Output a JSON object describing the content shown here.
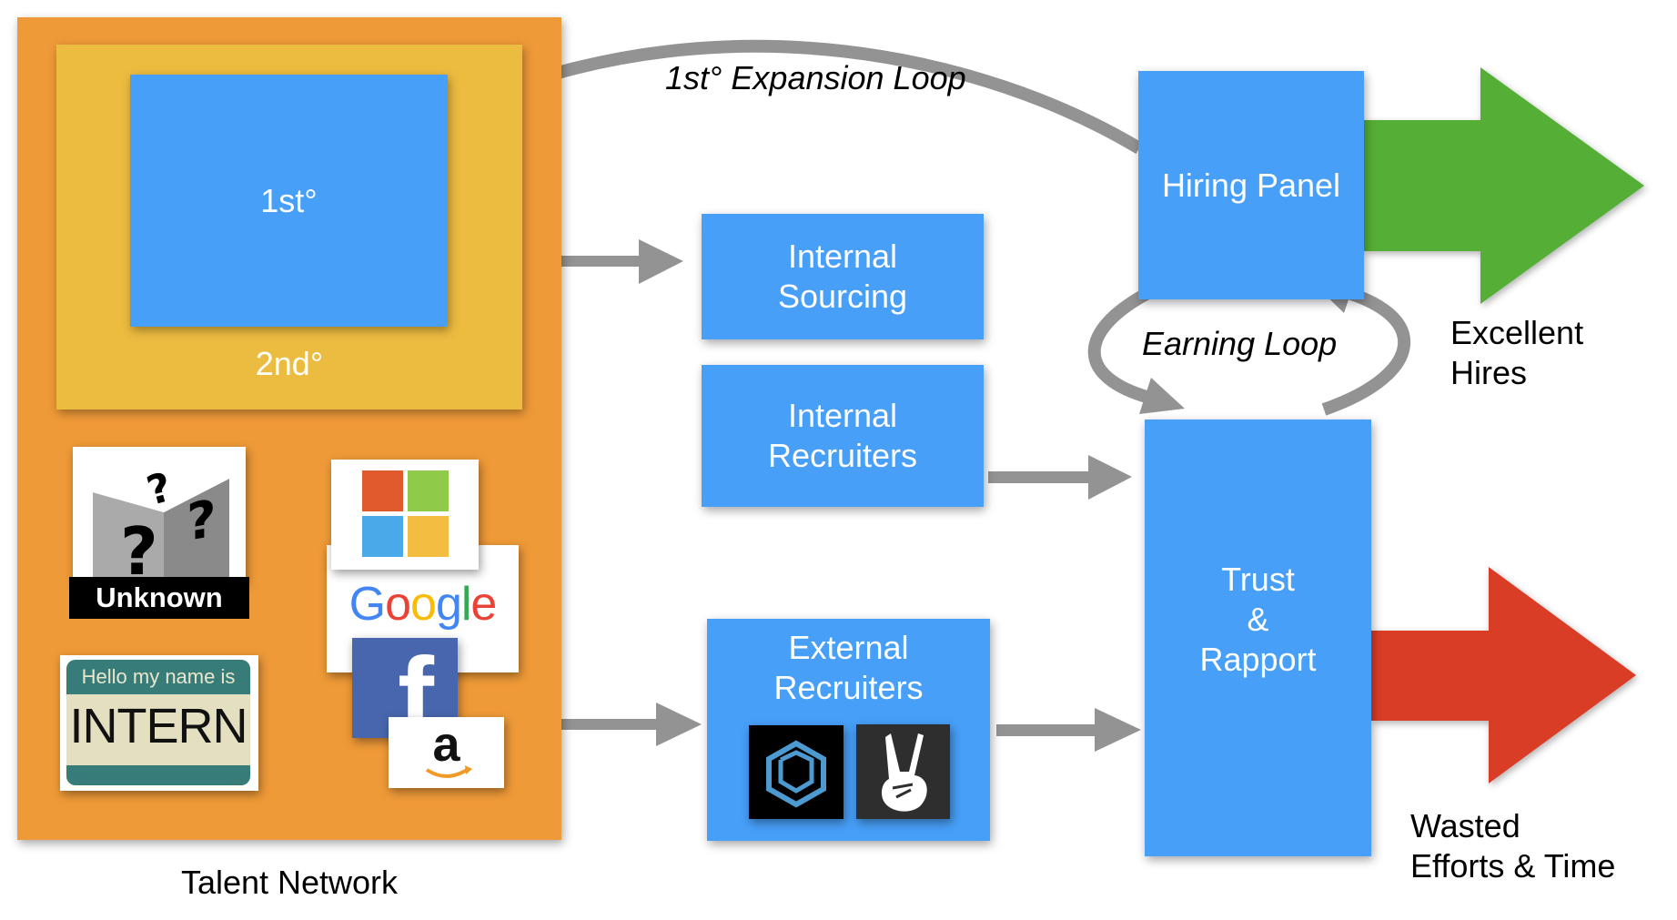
{
  "talent_network": {
    "label": "Talent Network",
    "first_degree": "1st°",
    "second_degree": "2nd°",
    "sources": {
      "unknown": "Unknown",
      "intern_header": "Hello my name is",
      "intern_name": "INTERN",
      "google": "Google",
      "facebook": "f",
      "amazon": "a"
    }
  },
  "nodes": {
    "internal_sourcing": "Internal\nSourcing",
    "internal_recruiters": "Internal\nRecruiters",
    "external_recruiters": "External\nRecruiters",
    "hiring_panel": "Hiring Panel",
    "trust_rapport": "Trust\n&\nRapport"
  },
  "loops": {
    "expansion": "1st° Expansion Loop",
    "earning": "Earning Loop"
  },
  "outcomes": {
    "excellent_hires": "Excellent\nHires",
    "wasted": "Wasted\nEfforts & Time"
  },
  "colors": {
    "node_blue": "#479ff8",
    "network_orange": "#ef9a38",
    "second_degree_yellow": "#ecbc40",
    "arrow_gray": "#939393",
    "success_green": "#55ae35",
    "waste_red": "#d93d27"
  }
}
